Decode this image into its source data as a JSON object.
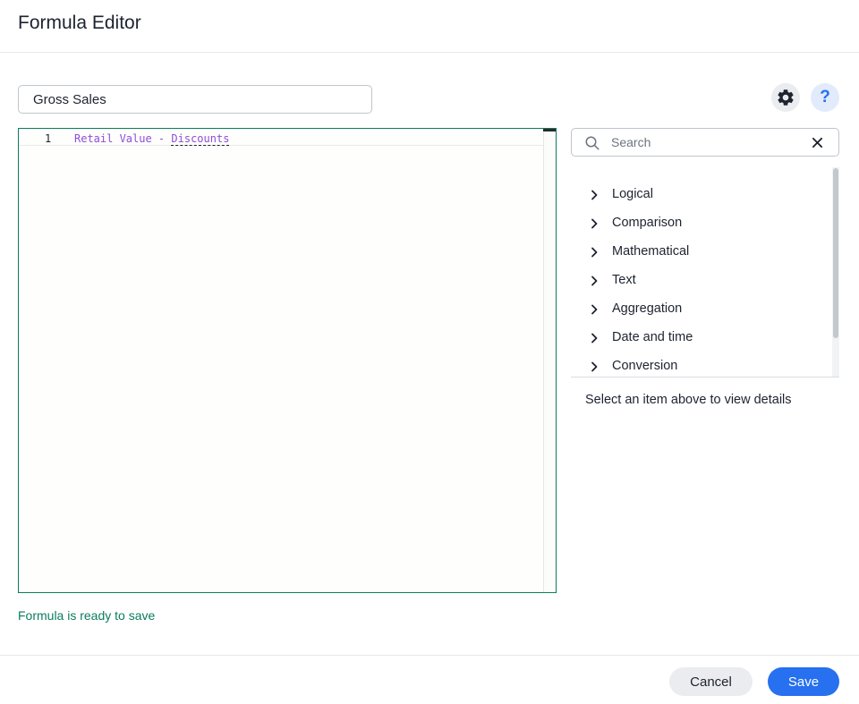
{
  "dialog": {
    "title": "Formula Editor"
  },
  "formula": {
    "name_value": "Gross Sales",
    "line_number": "1",
    "tokens": {
      "col1": "Retail Value",
      "op": " - ",
      "col2": "Discounts"
    }
  },
  "toolbar": {
    "settings_icon": "gear-icon",
    "help_label": "?"
  },
  "status": {
    "text": "Formula is ready to save",
    "color": "#0b7c5c"
  },
  "search": {
    "placeholder": "Search",
    "value": ""
  },
  "categories": [
    {
      "label": "Logical"
    },
    {
      "label": "Comparison"
    },
    {
      "label": "Mathematical"
    },
    {
      "label": "Text"
    },
    {
      "label": "Aggregation"
    },
    {
      "label": "Date and time"
    },
    {
      "label": "Conversion"
    }
  ],
  "details": {
    "text": "Select an item above to view details"
  },
  "footer": {
    "cancel_label": "Cancel",
    "save_label": "Save"
  },
  "colors": {
    "accent": "#2770ef",
    "token": "#8c4fd8",
    "success": "#0b7c5c"
  }
}
